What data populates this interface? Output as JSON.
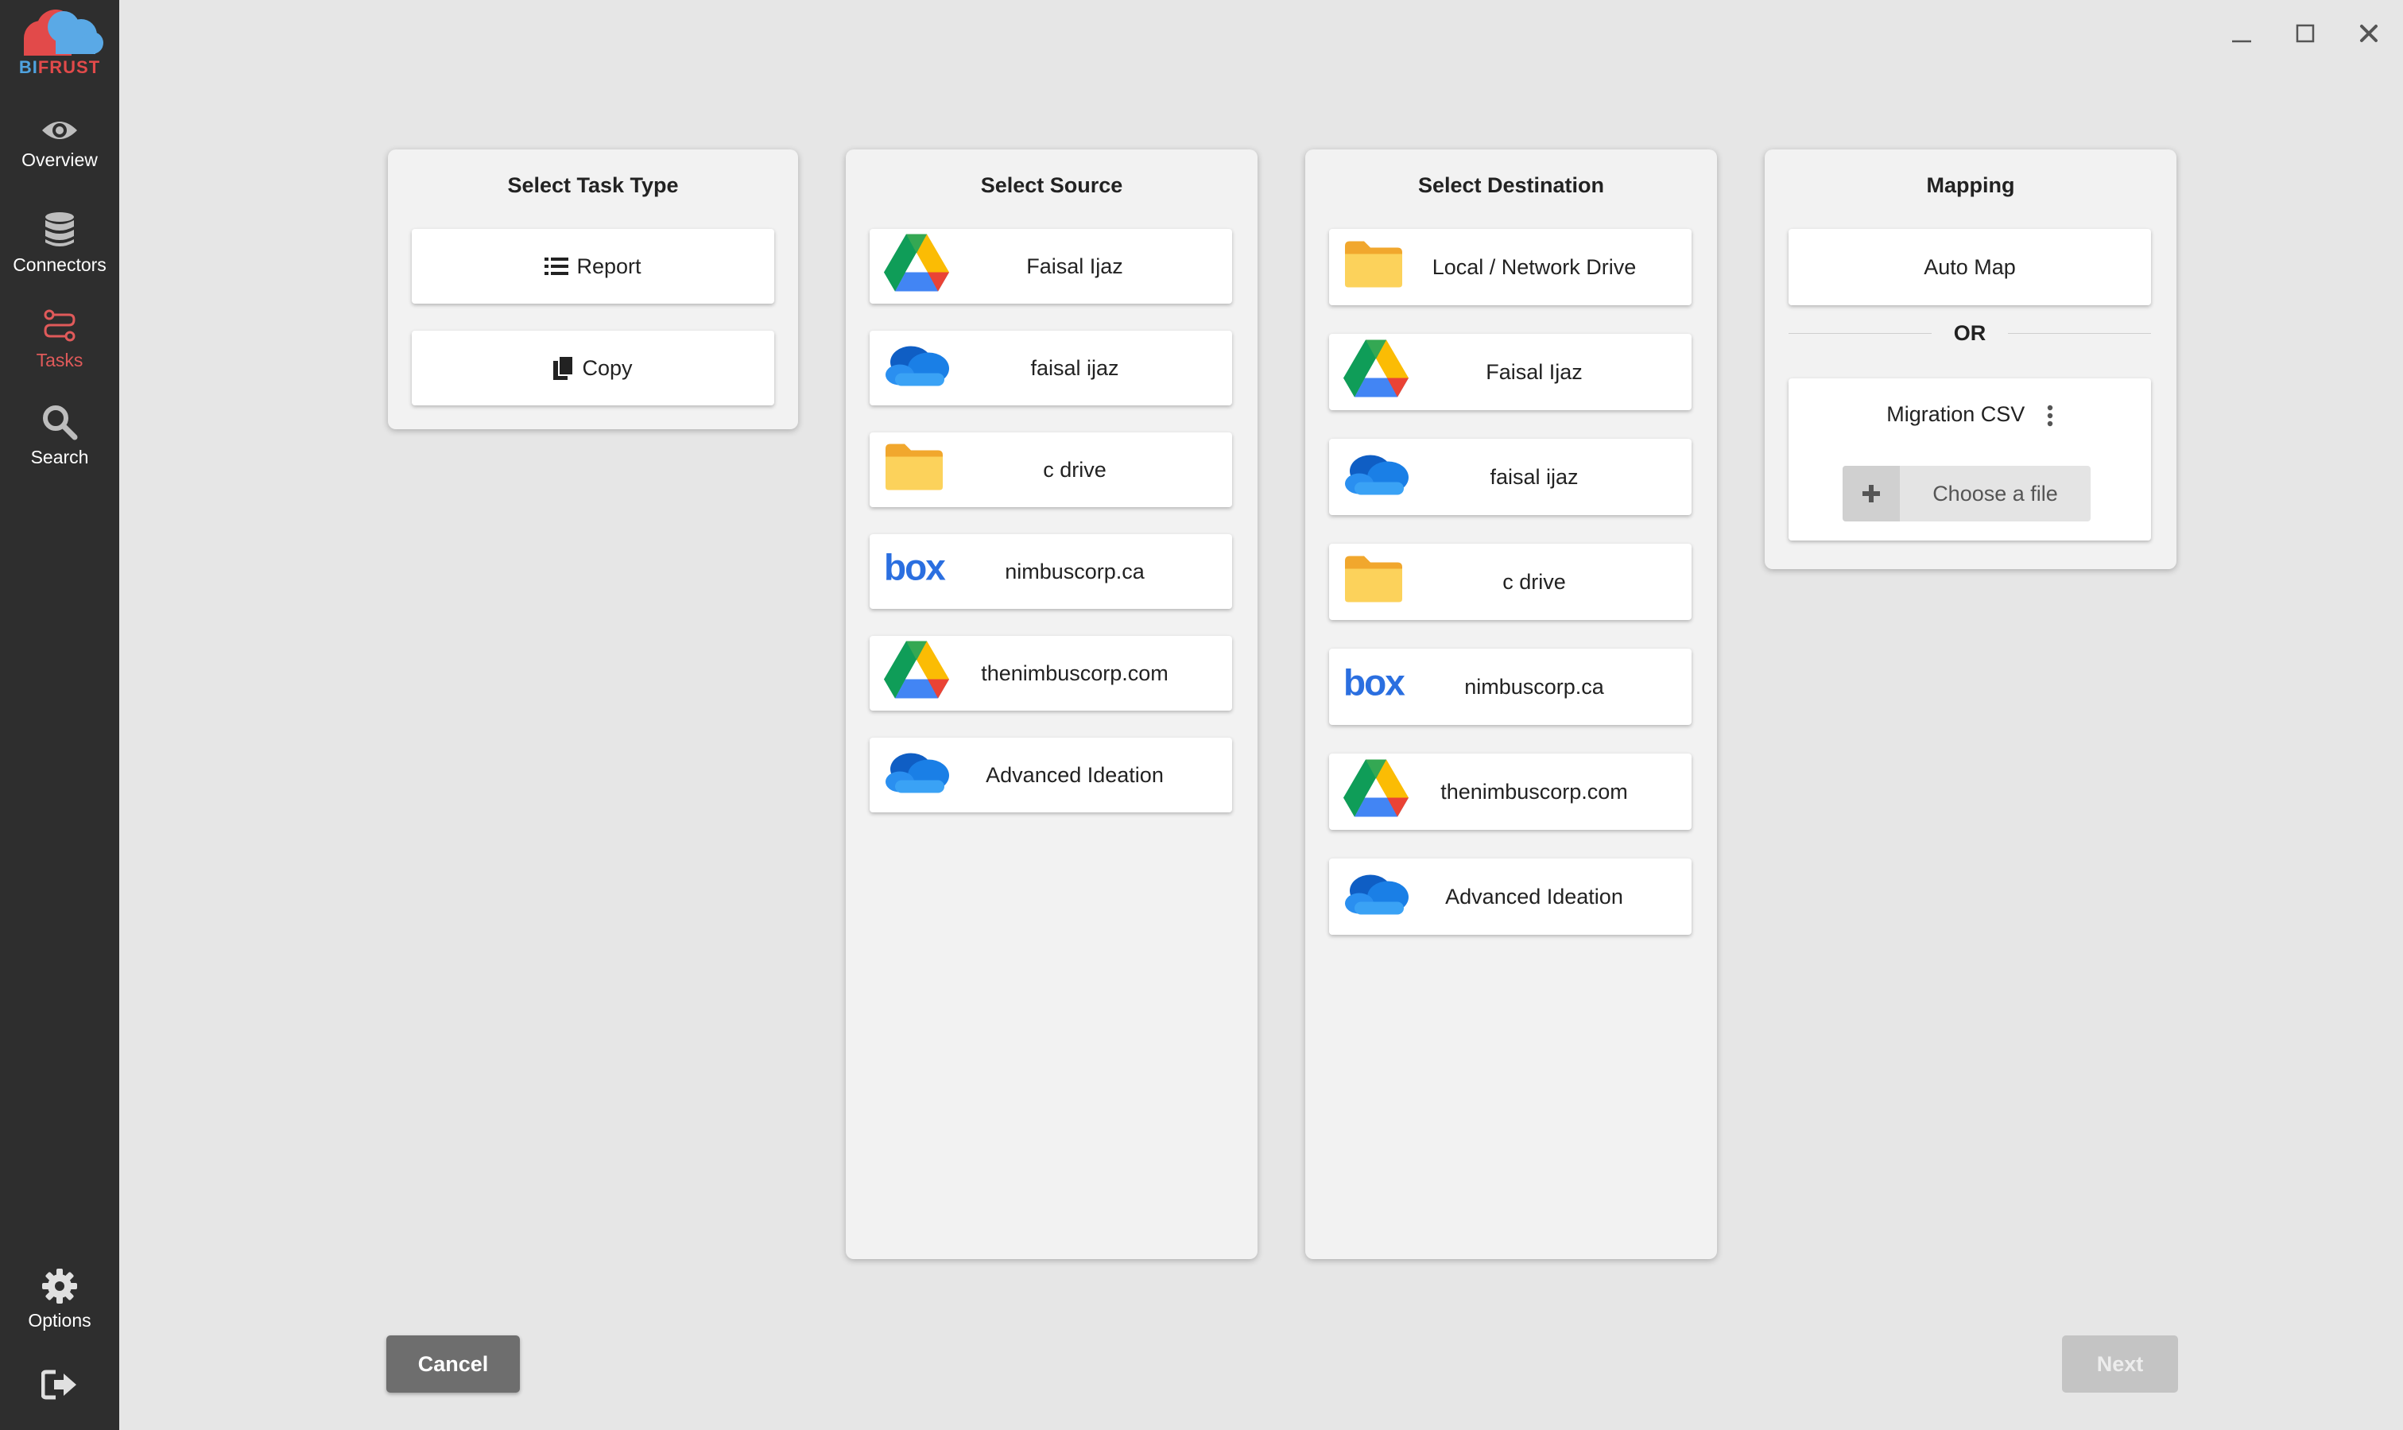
{
  "app": {
    "logo_text_a": "BI",
    "logo_text_b": "FRUST",
    "accent": "#e24a4a",
    "logo_cloud_blue": "#5aa9e6"
  },
  "sidebar": {
    "items": [
      {
        "label": "Overview",
        "icon": "eye-icon"
      },
      {
        "label": "Connectors",
        "icon": "database-icon"
      },
      {
        "label": "Tasks",
        "icon": "tasks-icon",
        "active": true
      },
      {
        "label": "Search",
        "icon": "search-icon"
      }
    ],
    "bottom": [
      {
        "label": "Options",
        "icon": "gear-icon"
      },
      {
        "label": "",
        "icon": "logout-icon"
      }
    ]
  },
  "window_controls": [
    "minimize-icon",
    "maximize-icon",
    "close-icon"
  ],
  "task_type": {
    "title": "Select Task Type",
    "options": [
      {
        "label": "Report",
        "icon": "list-icon"
      },
      {
        "label": "Copy",
        "icon": "copy-icon"
      }
    ]
  },
  "source": {
    "title": "Select Source",
    "items": [
      {
        "label": "Faisal Ijaz",
        "icon": "google-drive-icon"
      },
      {
        "label": "faisal ijaz",
        "icon": "onedrive-icon"
      },
      {
        "label": "c drive",
        "icon": "folder-icon"
      },
      {
        "label": "nimbuscorp.ca",
        "icon": "box-icon"
      },
      {
        "label": "thenimbuscorp.com",
        "icon": "google-drive-icon"
      },
      {
        "label": "Advanced Ideation",
        "icon": "onedrive-icon"
      }
    ]
  },
  "destination": {
    "title": "Select Destination",
    "items": [
      {
        "label": "Local / Network Drive",
        "icon": "folder-icon"
      },
      {
        "label": "Faisal Ijaz",
        "icon": "google-drive-icon"
      },
      {
        "label": "faisal ijaz",
        "icon": "onedrive-icon"
      },
      {
        "label": "c drive",
        "icon": "folder-icon"
      },
      {
        "label": "nimbuscorp.ca",
        "icon": "box-icon"
      },
      {
        "label": "thenimbuscorp.com",
        "icon": "google-drive-icon"
      },
      {
        "label": "Advanced Ideation",
        "icon": "onedrive-icon"
      }
    ]
  },
  "mapping": {
    "title": "Mapping",
    "auto_map": "Auto Map",
    "or": "OR",
    "csv_label": "Migration CSV",
    "choose_file": "Choose a file"
  },
  "footer": {
    "cancel": "Cancel",
    "next": "Next"
  }
}
